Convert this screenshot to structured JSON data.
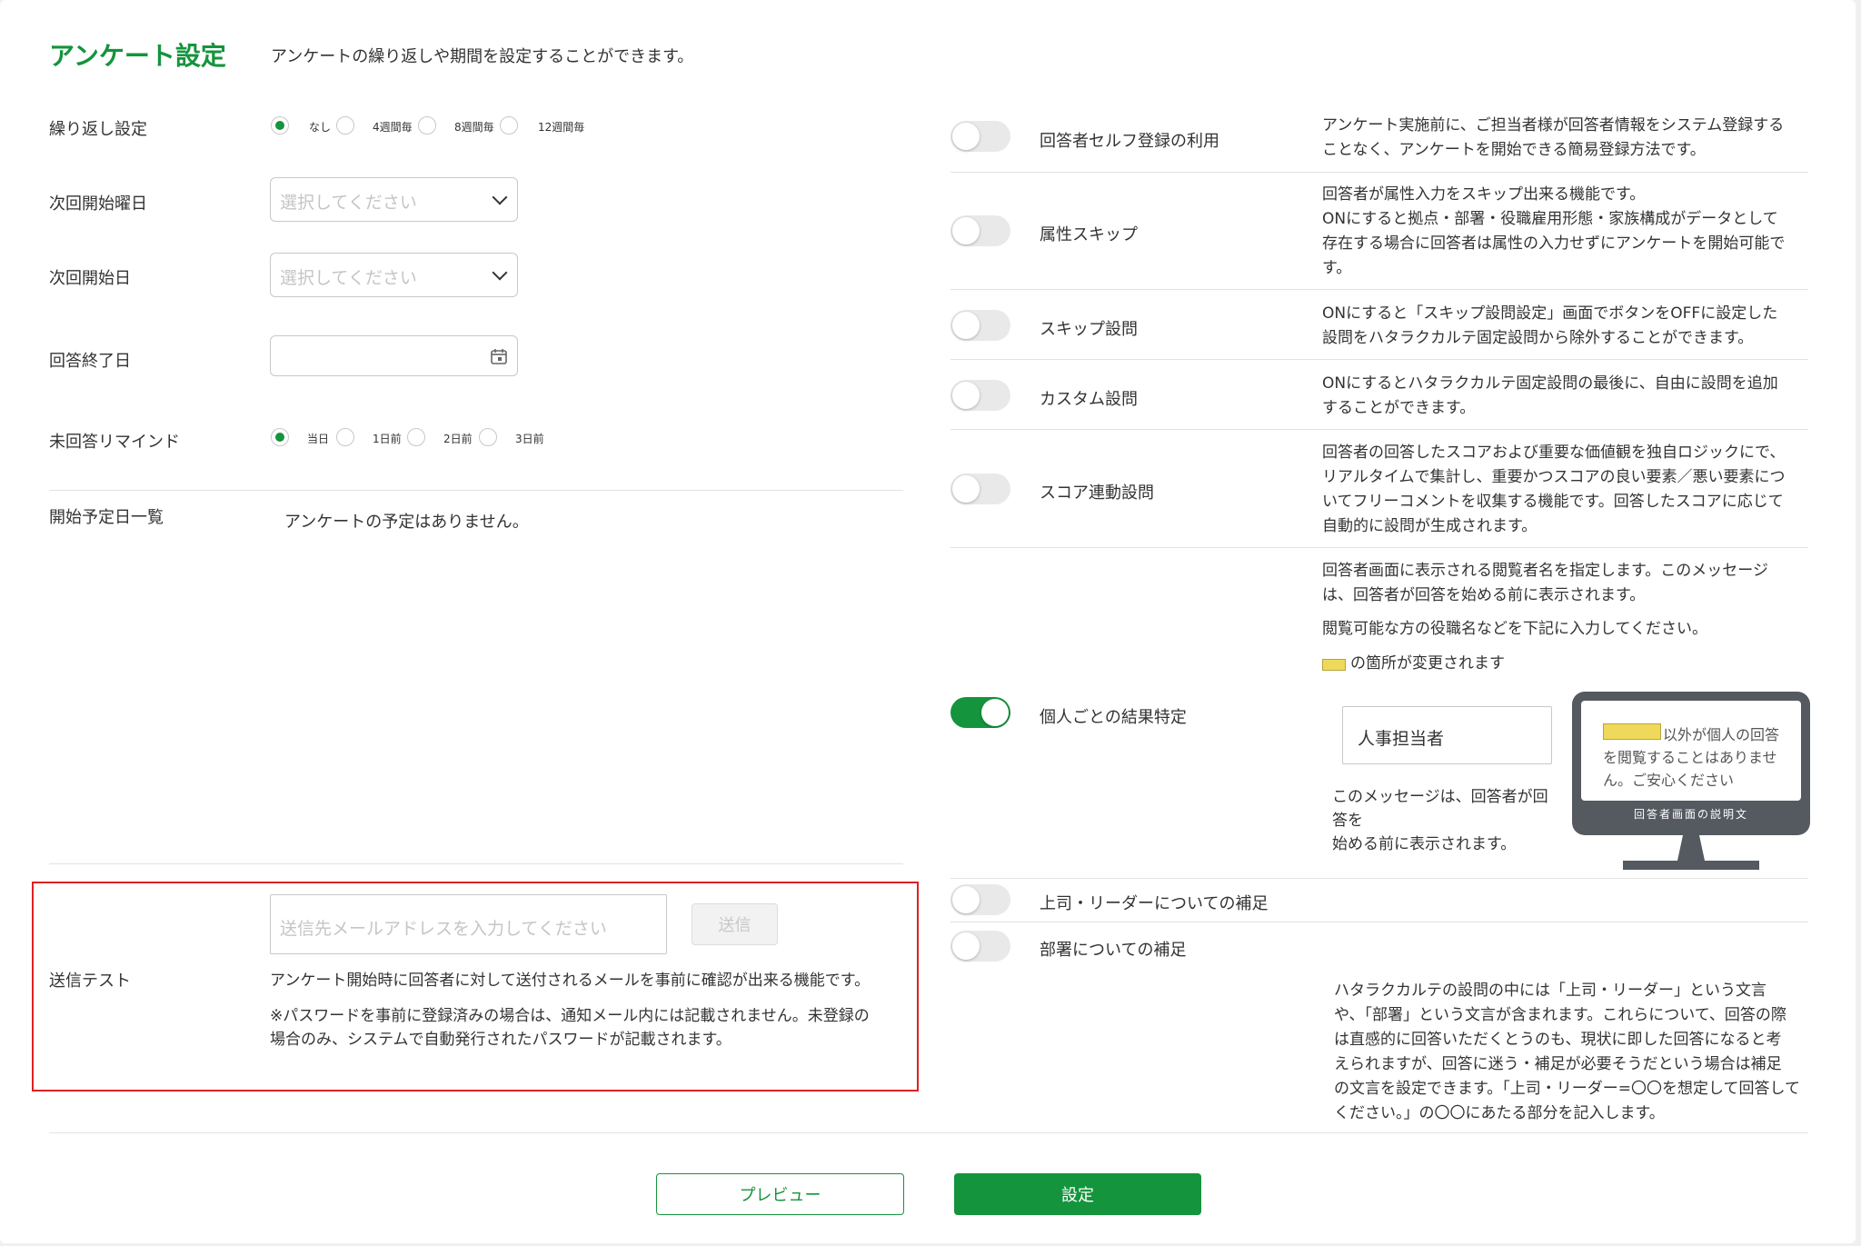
{
  "header": {
    "title": "アンケート設定",
    "subtitle": "アンケートの繰り返しや期間を設定することができます。"
  },
  "left": {
    "repeat": {
      "label": "繰り返し設定",
      "options": [
        "なし",
        "4週間毎",
        "8週間毎",
        "12週間毎"
      ],
      "selected": "なし"
    },
    "next_weekday": {
      "label": "次回開始曜日",
      "placeholder": "選択してください"
    },
    "next_date": {
      "label": "次回開始日",
      "placeholder": "選択してください"
    },
    "end_date": {
      "label": "回答終了日",
      "value": ""
    },
    "remind": {
      "label": "未回答リマインド",
      "options": [
        "当日",
        "1日前",
        "2日前",
        "3日前"
      ],
      "selected": "当日"
    },
    "schedule": {
      "label": "開始予定日一覧",
      "empty_text": "アンケートの予定はありません。"
    },
    "send_test": {
      "label": "送信テスト",
      "placeholder": "送信先メールアドレスを入力してください",
      "button": "送信",
      "desc1": "アンケート開始時に回答者に対して送付されるメールを事前に確認が出来る機能です。",
      "desc2a": "※パスワードを事前に登録済みの場合は、通知メール内には記載されません。未登録の",
      "desc2b": "場合のみ、システムで自動発行されたパスワードが記載されます。"
    }
  },
  "right": {
    "self_register": {
      "name": "回答者セルフ登録の利用",
      "on": false,
      "desc": [
        "アンケート実施前に、ご担当者様が回答者情報をシステム登録する",
        "ことなく、アンケートを開始できる簡易登録方法です。"
      ]
    },
    "attr_skip": {
      "name": "属性スキップ",
      "on": false,
      "desc": [
        "回答者が属性入力をスキップ出来る機能です。",
        "ONにすると拠点・部署・役職雇用形態・家族構成がデータとして",
        "存在する場合に回答者は属性の入力せずにアンケートを開始可能で",
        "す。"
      ]
    },
    "skip_q": {
      "name": "スキップ設問",
      "on": false,
      "desc": [
        "ONにすると「スキップ設問設定」画面でボタンをOFFに設定した",
        "設問をハタラクカルテ固定設問から除外することができます。"
      ]
    },
    "custom_q": {
      "name": "カスタム設問",
      "on": false,
      "desc": [
        "ONにするとハタラクカルテ固定設問の最後に、自由に設問を追加",
        "することができます。"
      ]
    },
    "score_q": {
      "name": "スコア連動設問",
      "on": false,
      "desc": [
        "回答者の回答したスコアおよび重要な価値観を独自ロジックにで、",
        "リアルタイムで集計し、重要かつスコアの良い要素／悪い要素につ",
        "いてフリーコメントを収集する機能です。回答したスコアに応じて",
        "自動的に設問が生成されます。"
      ]
    },
    "individual": {
      "name": "個人ごとの結果特定",
      "on": true,
      "desc": [
        "回答者画面に表示される閲覧者名を指定します。このメッセージ",
        "は、回答者が回答を始める前に表示されます。"
      ],
      "desc2": "閲覧可能な方の役職名などを下記に入力してください。",
      "legend": "の箇所が変更されます",
      "input_value": "人事担当者",
      "note": [
        "このメッセージは、回答者が回",
        "答を",
        "始める前に表示されます。"
      ],
      "monitor_text": [
        "以外が個人の回答",
        "を閲覧することはありませ",
        "ん。ご安心ください"
      ],
      "monitor_caption": "回答者画面の説明文"
    },
    "boss_note": {
      "name": "上司・リーダーについての補足",
      "on": false
    },
    "dept_note": {
      "name": "部署についての補足",
      "on": false,
      "desc": [
        "ハタラクカルテの設問の中には「上司・リーダー」という文言",
        "や、「部署」という文言が含まれます。これらについて、回答の際",
        "は直感的に回答いただくとうのも、現状に即した回答になると考",
        "えられますが、回答に迷う・補足が必要そうだという場合は補足",
        "の文言を設定できます。「上司・リーダー=〇〇を想定して回答して",
        "ください。」の〇〇にあたる部分を記入します。"
      ]
    }
  },
  "footer": {
    "preview": "プレビュー",
    "submit": "設定"
  },
  "colors": {
    "accent": "#14943c",
    "highlight_border": "#e02020",
    "marker_yellow": "#efd95a",
    "monitor": "#555a60"
  }
}
